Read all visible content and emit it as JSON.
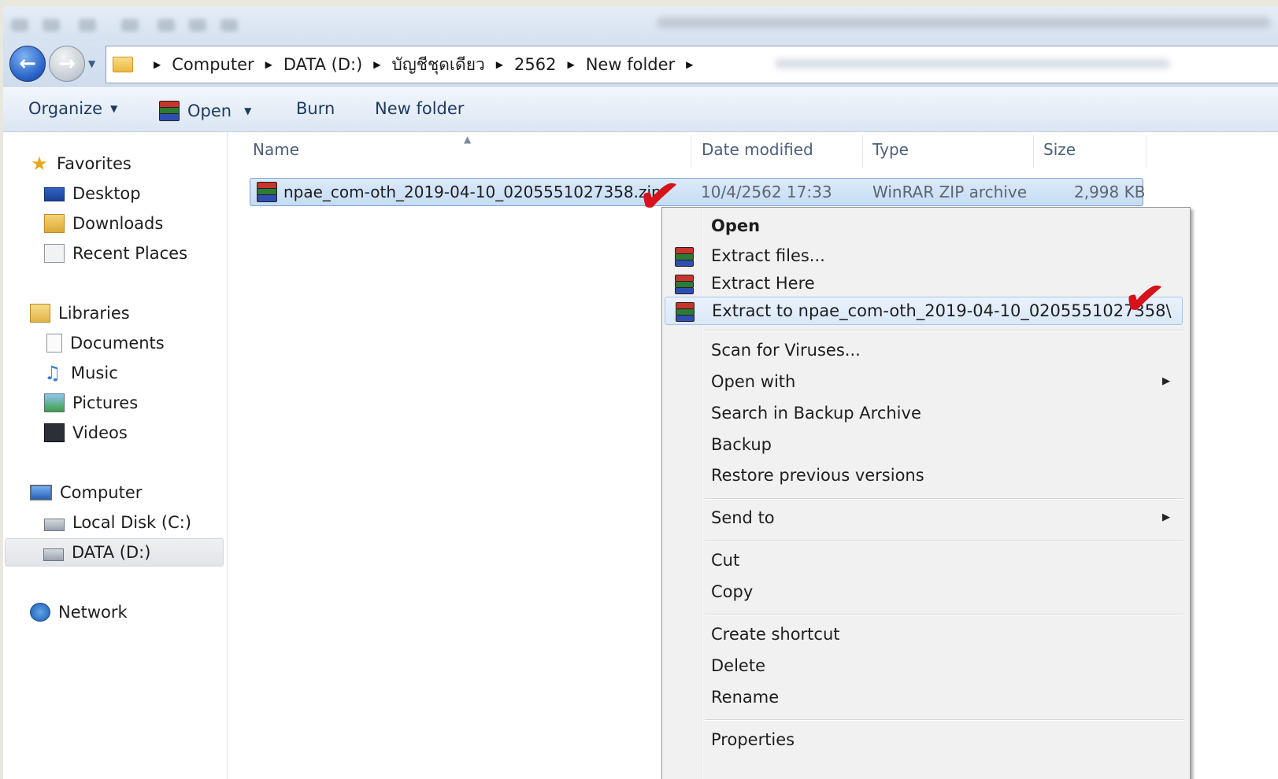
{
  "nav": {
    "back_icon": "back-arrow-icon",
    "forward_icon": "forward-arrow-icon",
    "breadcrumb": [
      "Computer",
      "DATA (D:)",
      "บัญชีชุดเดียว",
      "2562",
      "New folder"
    ]
  },
  "toolbar": {
    "organize": "Organize",
    "open": "Open",
    "burn": "Burn",
    "new_folder": "New folder"
  },
  "sidebar": {
    "favorites": "Favorites",
    "desktop": "Desktop",
    "downloads": "Downloads",
    "recent_places": "Recent Places",
    "libraries": "Libraries",
    "documents": "Documents",
    "music": "Music",
    "pictures": "Pictures",
    "videos": "Videos",
    "computer": "Computer",
    "local_disk": "Local Disk (C:)",
    "data_disk": "DATA (D:)",
    "network": "Network"
  },
  "columns": {
    "name": "Name",
    "date_modified": "Date modified",
    "type": "Type",
    "size": "Size"
  },
  "file": {
    "name": "npae_com-oth_2019-04-10_0205551027358.zip",
    "date_modified": "10/4/2562 17:33",
    "type": "WinRAR ZIP archive",
    "size": "2,998 KB"
  },
  "context_menu": {
    "open": "Open",
    "extract_files": "Extract files...",
    "extract_here": "Extract Here",
    "extract_to": "Extract to npae_com-oth_2019-04-10_0205551027358\\",
    "scan_viruses": "Scan for Viruses...",
    "open_with": "Open with",
    "search_backup": "Search in Backup Archive",
    "backup": "Backup",
    "restore": "Restore previous versions",
    "send_to": "Send to",
    "cut": "Cut",
    "copy": "Copy",
    "create_shortcut": "Create shortcut",
    "delete": "Delete",
    "rename": "Rename",
    "properties": "Properties"
  },
  "annotation": {
    "checkmark_color": "#d6121a",
    "checkmark_icon": "red-checkmark-icon"
  }
}
